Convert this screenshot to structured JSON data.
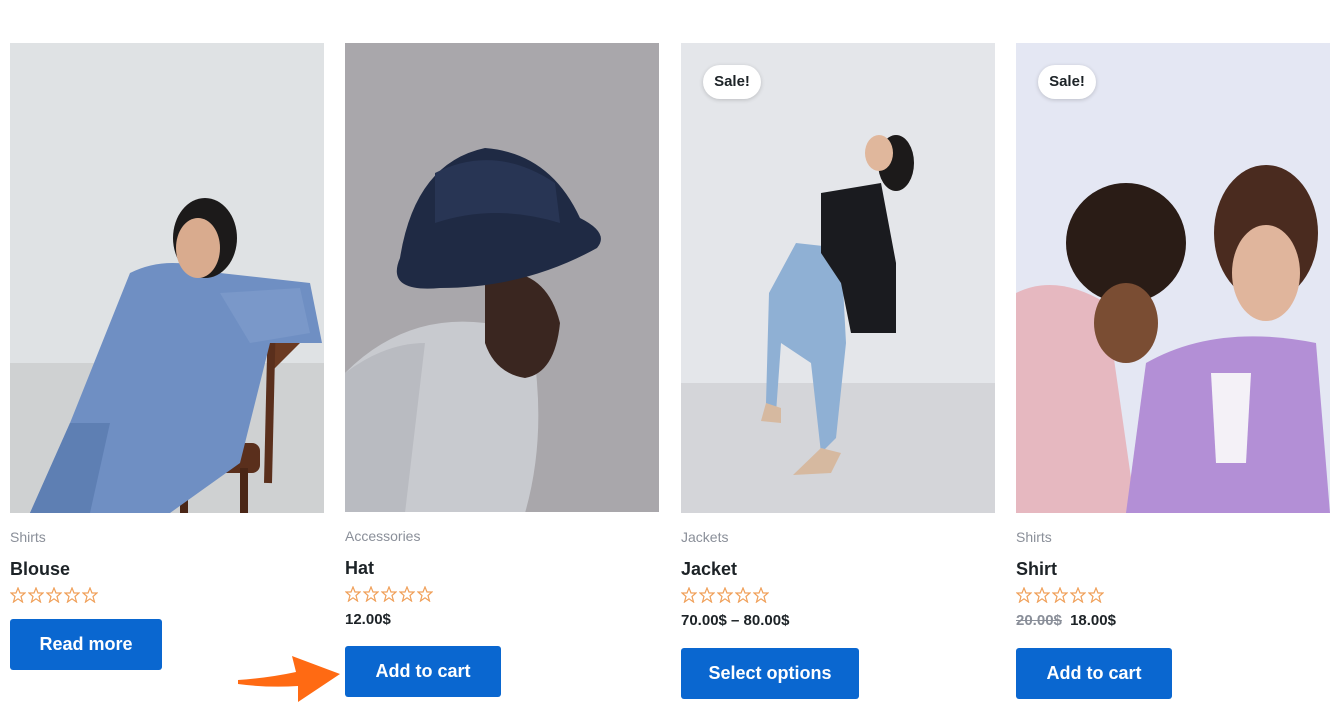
{
  "sale_badge": "Sale!",
  "accent_color": "#0a67d0",
  "star_color": "#f0a05a",
  "arrow_color": "#ff6a13",
  "products": [
    {
      "category": "Shirts",
      "title": "Blouse",
      "rating": 0,
      "price": "",
      "old_price": "",
      "button": "Read more",
      "on_sale": false
    },
    {
      "category": "Accessories",
      "title": "Hat",
      "rating": 0,
      "price": "12.00$",
      "old_price": "",
      "button": "Add to cart",
      "on_sale": false
    },
    {
      "category": "Jackets",
      "title": "Jacket",
      "rating": 0,
      "price": "70.00$ – 80.00$",
      "old_price": "",
      "button": "Select options",
      "on_sale": true
    },
    {
      "category": "Shirts",
      "title": "Shirt",
      "rating": 0,
      "price": "18.00$",
      "old_price": "20.00$",
      "button": "Add to cart",
      "on_sale": true
    }
  ]
}
